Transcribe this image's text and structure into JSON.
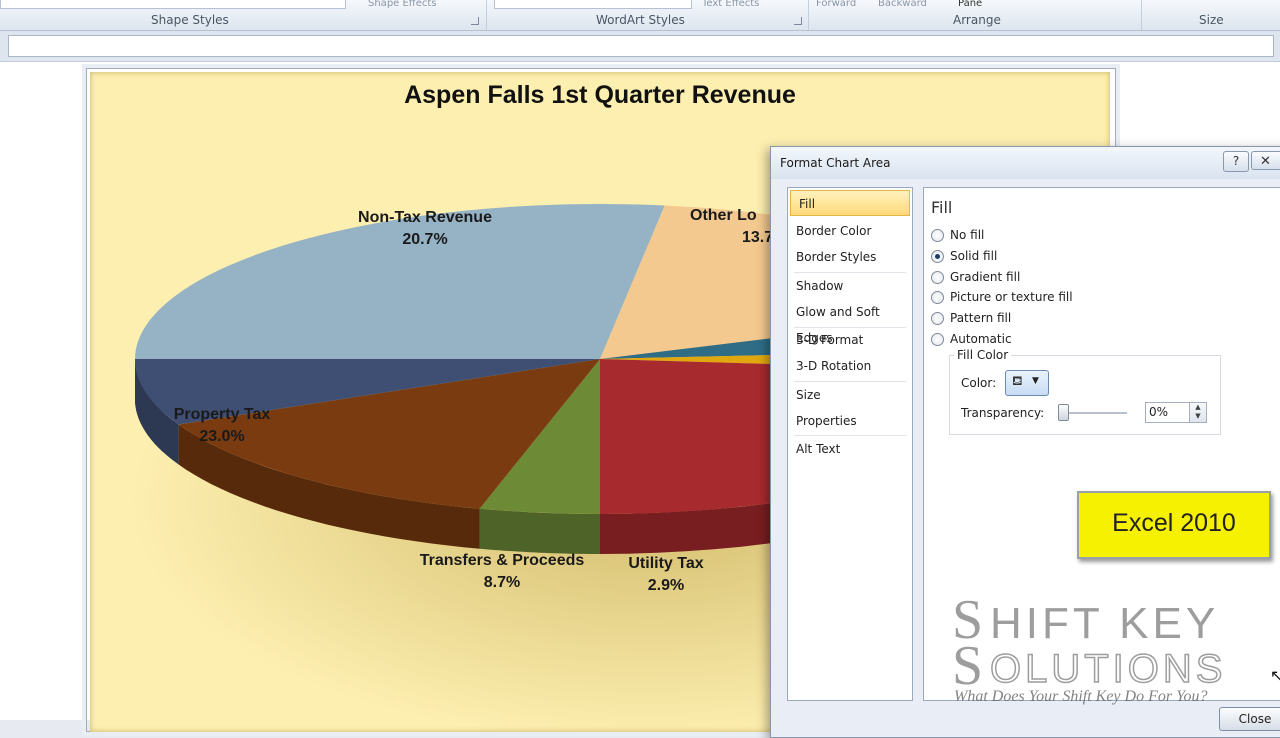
{
  "ribbon": {
    "groups": {
      "shape_styles": "Shape Styles",
      "wordart_styles": "WordArt Styles",
      "arrange": "Arrange",
      "size": "Size"
    },
    "partial": {
      "shape_effects": "Shape Effects",
      "text_effects": "Text Effects",
      "forward": "Forward",
      "backward": "Backward",
      "pane": "Pane"
    }
  },
  "chart": {
    "title": "Aspen Falls 1st Quarter Revenue"
  },
  "chart_data": {
    "type": "pie",
    "title": "Aspen Falls 1st Quarter Revenue",
    "categories": [
      "Non-Tax Revenue",
      "Other Local Taxes",
      "Property Tax",
      "Transfers & Proceeds",
      "Utility Tax"
    ],
    "values": [
      20.7,
      13.7,
      23.0,
      8.7,
      2.9
    ],
    "labels": [
      {
        "name": "Non-Tax Revenue",
        "pct": "20.7%"
      },
      {
        "name": "Other Lo",
        "pct": "13.7"
      },
      {
        "name": "Property Tax",
        "pct": "23.0%"
      },
      {
        "name": "Transfers & Proceeds",
        "pct": "8.7%"
      },
      {
        "name": "Utility Tax",
        "pct": "2.9%"
      }
    ],
    "colors": {
      "non_tax_revenue": "#95b3c4",
      "other_local_taxes": "#f4c98f",
      "property_tax": "#3f4f73",
      "transfers_proceeds": "#7a3b10",
      "utility_tax": "#6d8a36",
      "teal_slice": "#2f6d86",
      "gold_slice": "#e0a80e",
      "red_slice": "#a72a2e"
    },
    "legend": "none",
    "grid": false
  },
  "dialog": {
    "title": "Format Chart Area",
    "help": "?",
    "close_x": "✕",
    "nav": [
      {
        "label": "Fill",
        "selected": true
      },
      {
        "label": "Border Color"
      },
      {
        "label": "Border Styles"
      },
      {
        "label": "Shadow"
      },
      {
        "label": "Glow and Soft Edges"
      },
      {
        "label": "3-D Format"
      },
      {
        "label": "3-D Rotation"
      },
      {
        "label": "Size"
      },
      {
        "label": "Properties"
      },
      {
        "label": "Alt Text"
      }
    ],
    "fill_heading": "Fill",
    "options": [
      {
        "label": "No fill",
        "checked": false
      },
      {
        "label": "Solid fill",
        "checked": true
      },
      {
        "label": "Gradient fill",
        "checked": false
      },
      {
        "label": "Picture or texture fill",
        "checked": false
      },
      {
        "label": "Pattern fill",
        "checked": false
      },
      {
        "label": "Automatic",
        "checked": false
      }
    ],
    "fill_color_legend": "Fill Color",
    "color_label": "Color:",
    "transparency_label": "Transparency:",
    "transparency_value": "0%",
    "transparency_level": 0,
    "close_button": "Close"
  },
  "badge": {
    "text": "Excel 2010",
    "color": "#f5f100"
  },
  "watermark": {
    "logo": "SHIFT KEY SOLUTIONS",
    "tagline": "What Does Your Shift Key Do For You?"
  }
}
